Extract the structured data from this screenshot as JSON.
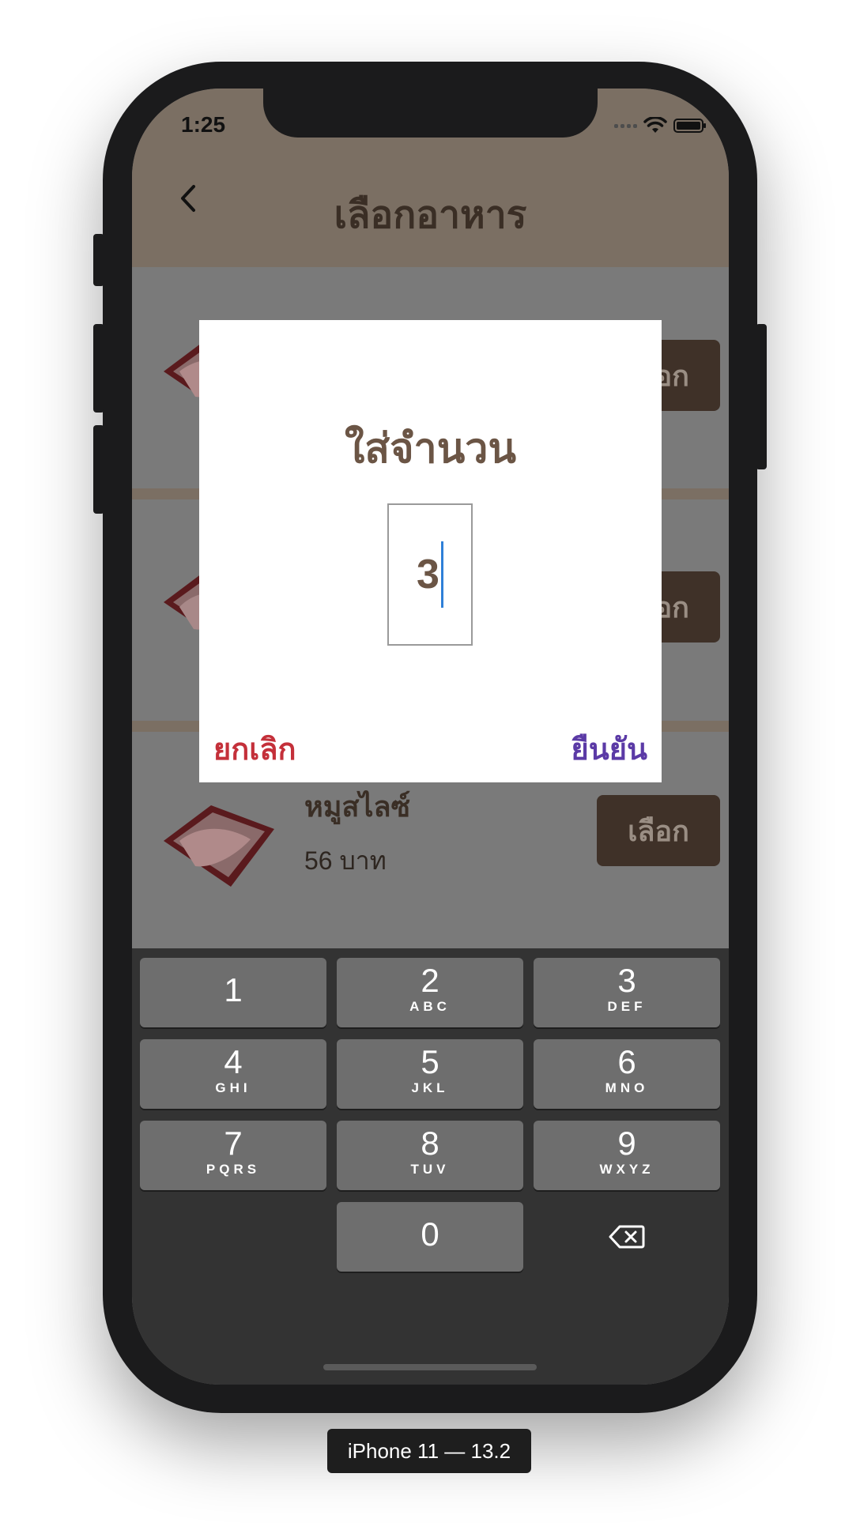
{
  "status_bar": {
    "time": "1:25"
  },
  "header": {
    "title": "เลือกอาหาร",
    "back_icon": "chevron-left-icon"
  },
  "menu_items": [
    {
      "name": "",
      "price": "",
      "select_label": "เลือก"
    },
    {
      "name": "",
      "price": "",
      "select_label": "เลือก"
    },
    {
      "name": "หมูสไลซ์",
      "price": "56 บาท",
      "select_label": "เลือก"
    }
  ],
  "dialog": {
    "title": "ใส่จำนวน",
    "quantity_value": "3",
    "cancel_label": "ยกเลิก",
    "confirm_label": "ยืนยัน"
  },
  "keyboard": {
    "keys": [
      {
        "num": "1",
        "sub": ""
      },
      {
        "num": "2",
        "sub": "ABC"
      },
      {
        "num": "3",
        "sub": "DEF"
      },
      {
        "num": "4",
        "sub": "GHI"
      },
      {
        "num": "5",
        "sub": "JKL"
      },
      {
        "num": "6",
        "sub": "MNO"
      },
      {
        "num": "7",
        "sub": "PQRS"
      },
      {
        "num": "8",
        "sub": "TUV"
      },
      {
        "num": "9",
        "sub": "WXYZ"
      },
      {
        "num": "0",
        "sub": ""
      }
    ],
    "delete_icon": "backspace-icon"
  },
  "device_label": "iPhone 11 — 13.2",
  "colors": {
    "header_bg": "#7b6f63",
    "select_button": "#3f3128",
    "cancel": "#c4303a",
    "confirm": "#5b3aa6",
    "caret": "#2f80d8"
  }
}
